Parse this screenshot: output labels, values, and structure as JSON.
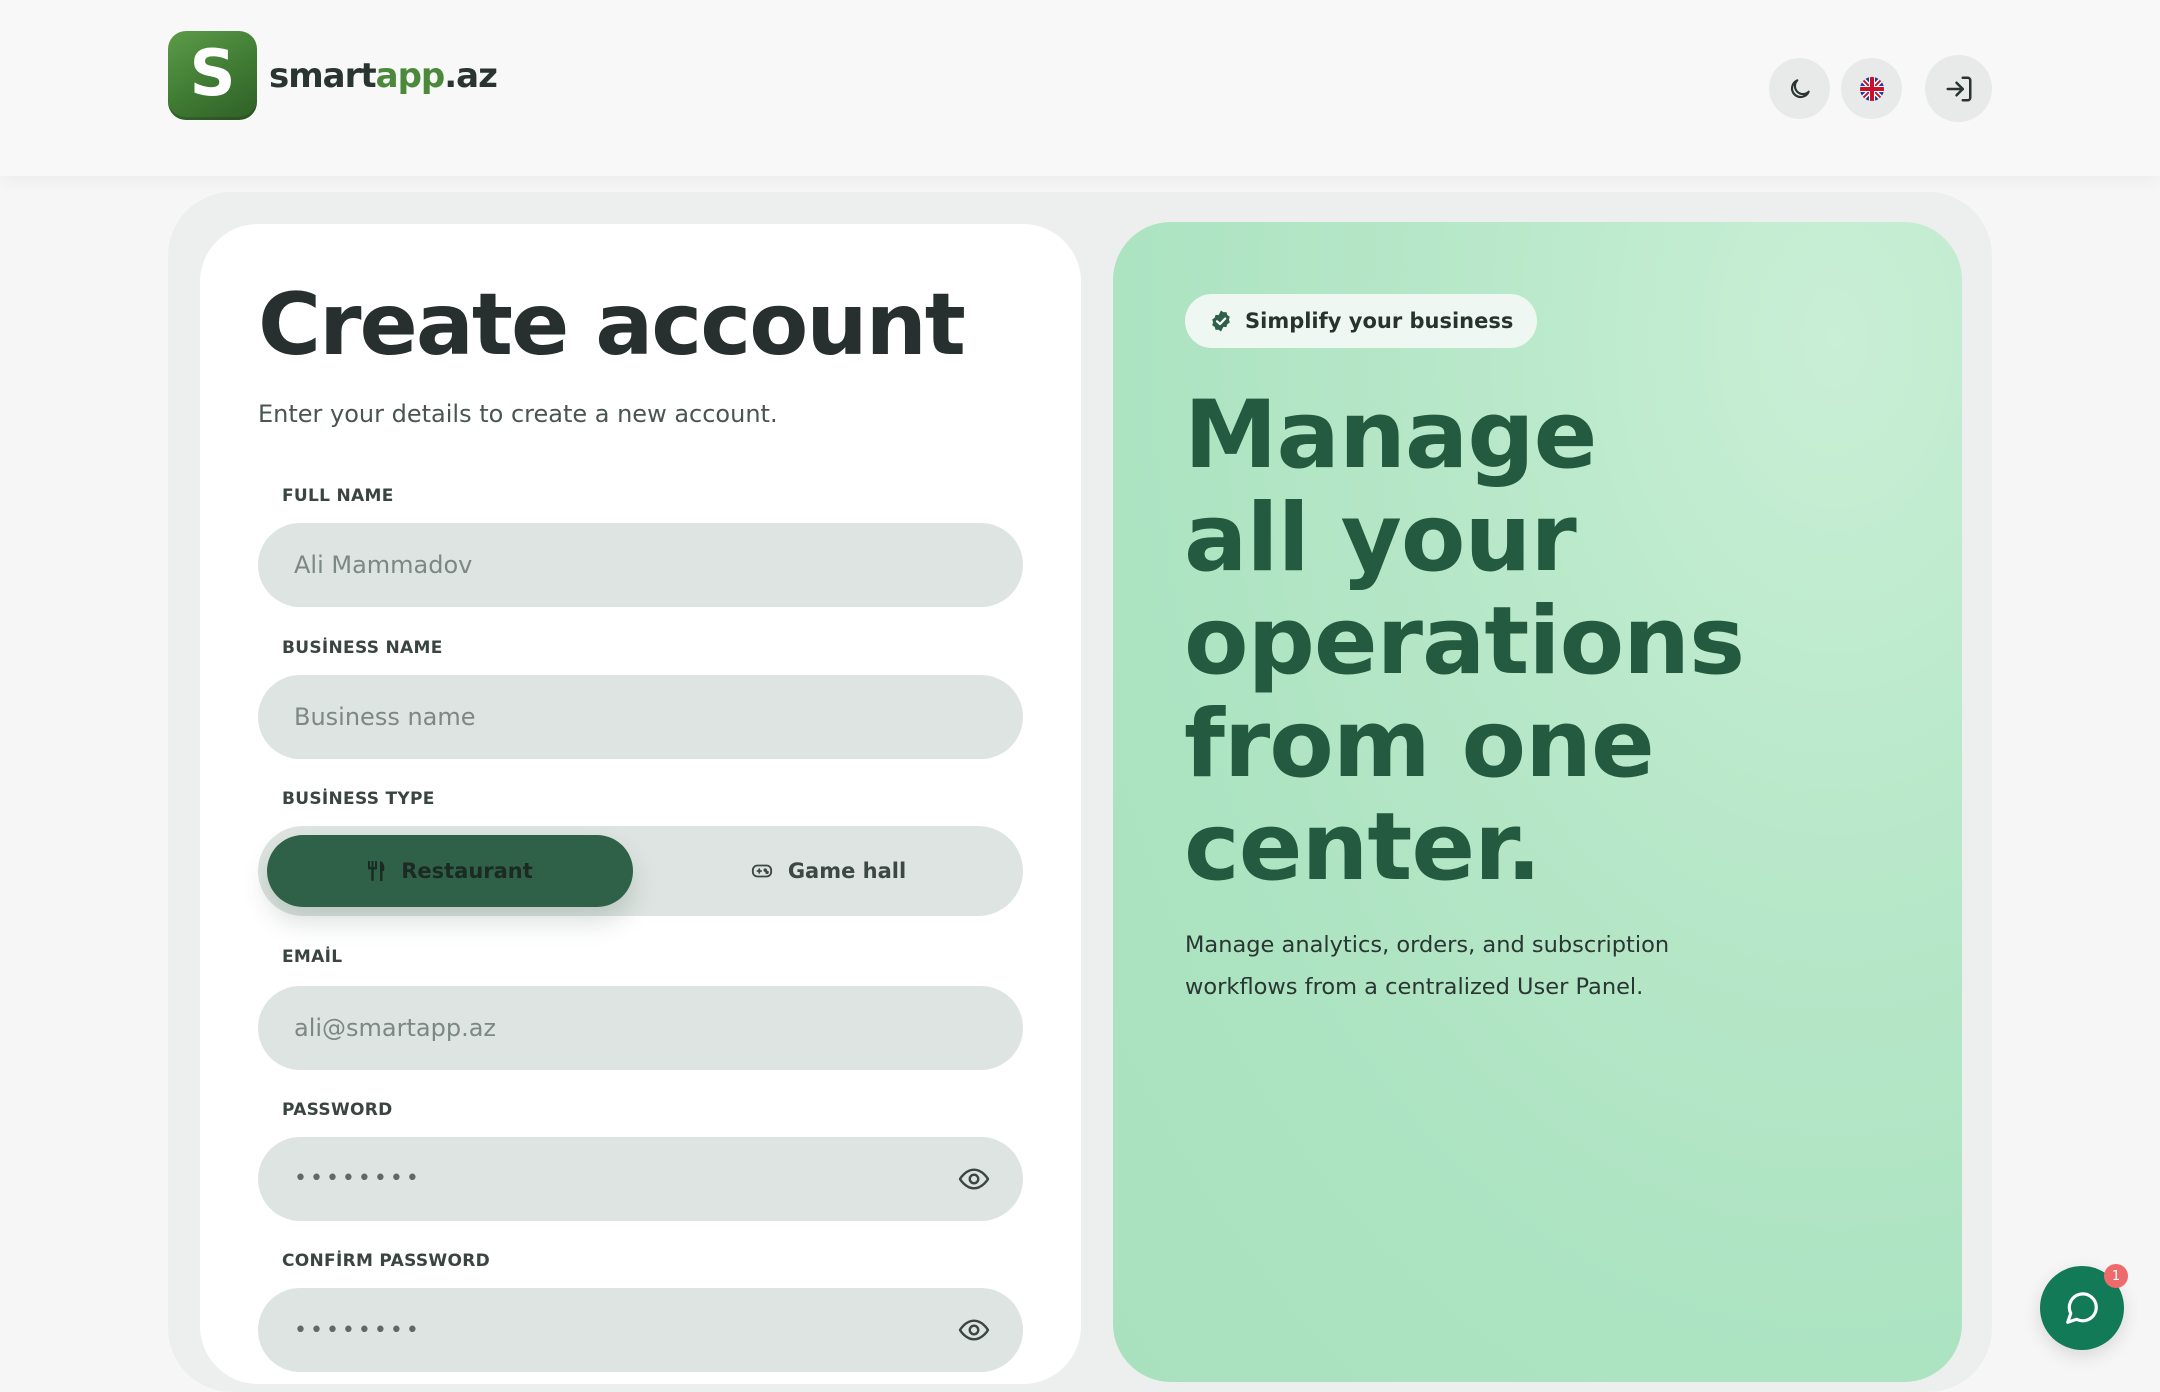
{
  "header": {
    "logo_letter": "S",
    "logo_text_part1": "smart",
    "logo_text_part2": "app",
    "logo_text_part3": ".az",
    "buttons": [
      "moon-icon",
      "uk-flag-icon",
      "login-icon"
    ]
  },
  "form": {
    "title": "Create account",
    "subtitle": "Enter your details to create a new account.",
    "full_name": {
      "label": "FULL NAME",
      "placeholder": "Ali Mammadov"
    },
    "business_name": {
      "label": "BUSİNESS NAME",
      "placeholder": "Business name"
    },
    "business_type": {
      "label": "BUSİNESS TYPE",
      "options": [
        {
          "label": "Restaurant",
          "icon": "fork-knife-icon",
          "selected": true
        },
        {
          "label": "Game hall",
          "icon": "gamepad-icon",
          "selected": false
        }
      ]
    },
    "email": {
      "label": "EMAİL",
      "placeholder": "ali@smartapp.az"
    },
    "password": {
      "label": "PASSWORD",
      "value_masked": "••••••••"
    },
    "confirm_password": {
      "label": "CONFİRM PASSWORD",
      "value_masked": "••••••••"
    }
  },
  "hero": {
    "chip": "Simplify your business",
    "title": "Manage all your operations from one center.",
    "description": "Manage analytics, orders, and subscription workflows from a centralized User Panel."
  },
  "chat": {
    "badge": "1"
  },
  "colors": {
    "brand_green": "#2f6148",
    "hero_title": "#245a40",
    "hero_bg": "#ace3c1",
    "fab": "#127a57",
    "badge": "#ef6b6b"
  }
}
